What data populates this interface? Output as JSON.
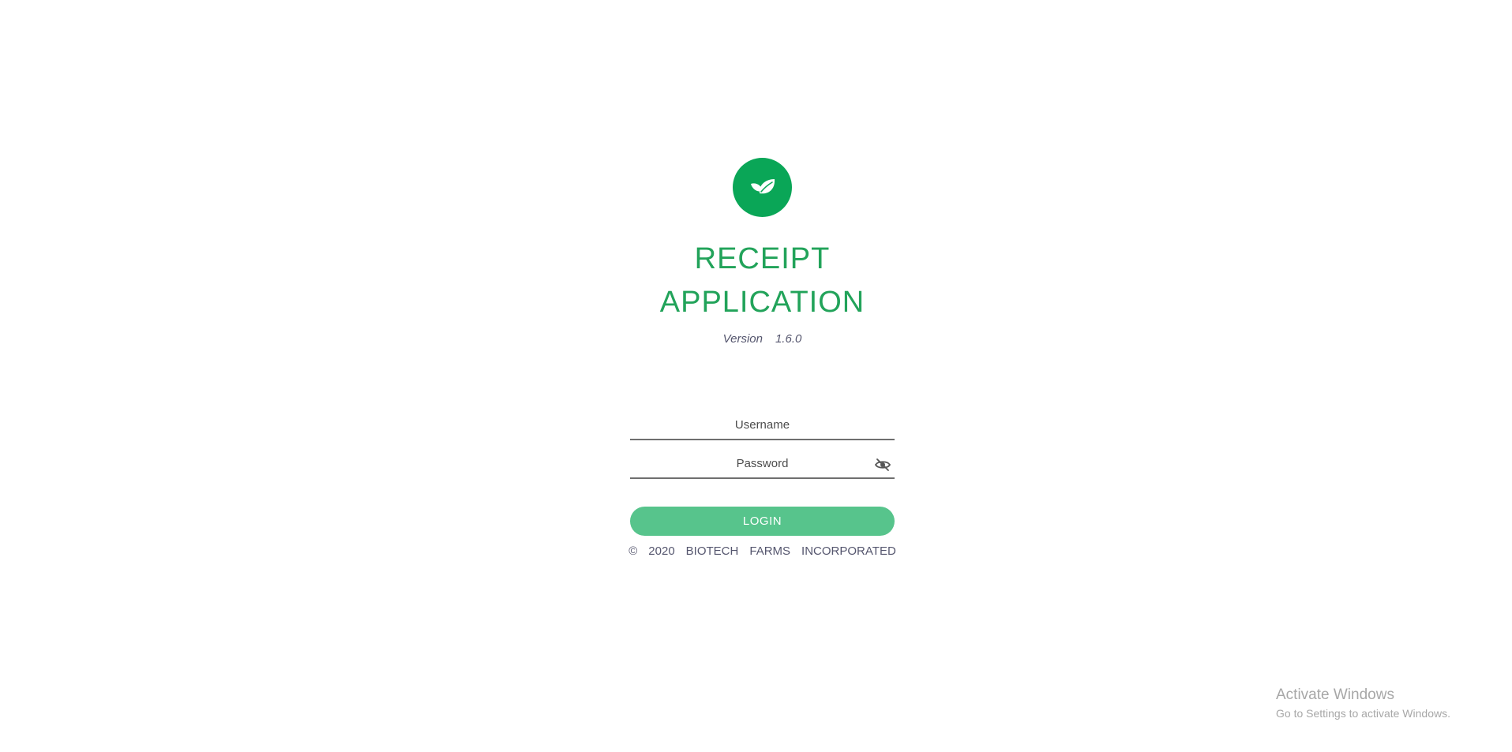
{
  "app": {
    "title_line1": "RECEIPT",
    "title_line2": "APPLICATION",
    "version_label": "Version",
    "version_number": "1.6.0",
    "logo_icon": "leaf-icon",
    "brand_color": "#0aa657"
  },
  "form": {
    "username_placeholder": "Username",
    "password_placeholder": "Password",
    "toggle_icon": "eye-off-icon",
    "login_label": "LOGIN",
    "button_color": "#57c48c"
  },
  "footer": {
    "copyright_symbol": "©",
    "year": "2020",
    "company_word1": "BIOTECH",
    "company_word2": "FARMS",
    "company_word3": "INCORPORATED"
  },
  "watermark": {
    "title": "Activate Windows",
    "subtitle": "Go to Settings to activate Windows."
  }
}
